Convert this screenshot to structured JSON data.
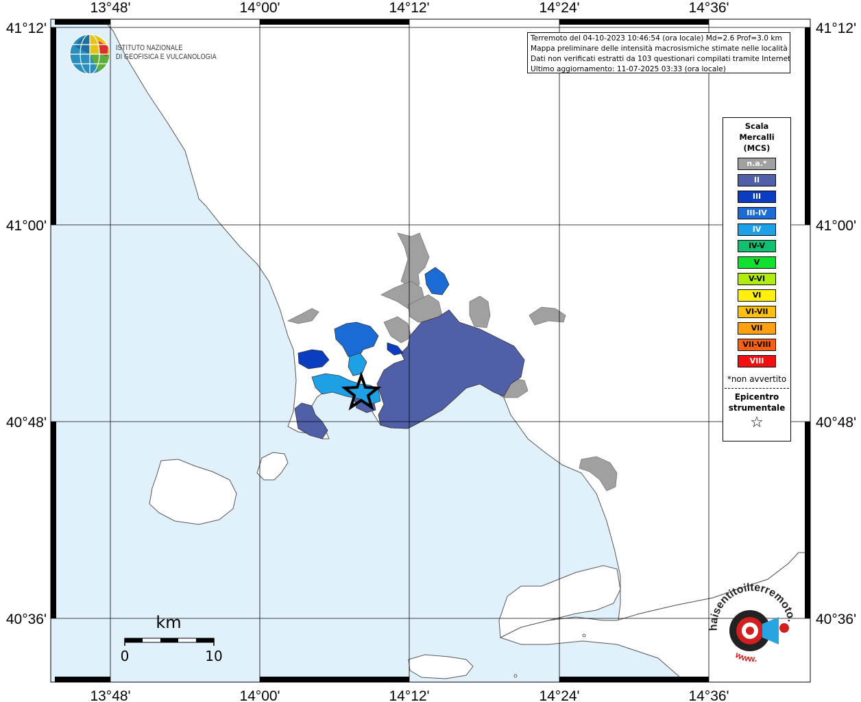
{
  "axes": {
    "longitude_labels": [
      "13°48'",
      "14°00'",
      "14°12'",
      "14°24'",
      "14°36'"
    ],
    "latitude_labels": [
      "41°12'",
      "41°00'",
      "40°48'",
      "40°36'"
    ]
  },
  "info": {
    "line1": "Terremoto del 04-10-2023 10:46:54 (ora locale) Md=2.6 Prof=3.0 km",
    "line2": "Mappa preliminare delle intensità macrosismiche stimate nelle località",
    "line3": "Dati non verificati estratti da 103 questionari compilati tramite Internet.",
    "line4": "Ultimo aggiornamento: 11-07-2025 03:33 (ora locale)"
  },
  "logo": {
    "line1": "ISTITUTO NAZIONALE",
    "line2": "DI GEOFISICA E VULCANOLOGIA"
  },
  "legend": {
    "title_line1": "Scala",
    "title_line2": "Mercalli",
    "title_line3": "(MCS)",
    "items": [
      {
        "label": "n.a.*",
        "color": "#a0a0a0",
        "text_color": "#ffffff"
      },
      {
        "label": "II",
        "color": "#5060a8",
        "text_color": "#ffffff"
      },
      {
        "label": "III",
        "color": "#0a3dbf",
        "text_color": "#ffffff"
      },
      {
        "label": "III-IV",
        "color": "#1a6bd6",
        "text_color": "#ffffff"
      },
      {
        "label": "IV",
        "color": "#1ea0e6",
        "text_color": "#ffffff"
      },
      {
        "label": "IV-V",
        "color": "#10c070",
        "text_color": "#000000"
      },
      {
        "label": "V",
        "color": "#10e030",
        "text_color": "#000000"
      },
      {
        "label": "V-VI",
        "color": "#b0ec10",
        "text_color": "#000000"
      },
      {
        "label": "VI",
        "color": "#fff010",
        "text_color": "#000000"
      },
      {
        "label": "VI-VII",
        "color": "#ffc010",
        "text_color": "#000000"
      },
      {
        "label": "VII",
        "color": "#ffa010",
        "text_color": "#000000"
      },
      {
        "label": "VII-VIII",
        "color": "#ff6010",
        "text_color": "#000000"
      },
      {
        "label": "VIII",
        "color": "#f01010",
        "text_color": "#ffffff"
      }
    ],
    "note": "*non avvertito",
    "epicenter_line1": "Epicentro",
    "epicenter_line2": "strumentale",
    "star_symbol": "☆"
  },
  "scale_bar": {
    "unit": "km",
    "min": "0",
    "max": "10"
  },
  "colors": {
    "sea": "#e1f1fc",
    "land": "#ffffff",
    "frame": "#000000"
  },
  "hsi_logo": {
    "text_top": "haisentitoilterremoto.it",
    "text_bottom": "www.",
    "icon": "target-megaphone-icon"
  }
}
